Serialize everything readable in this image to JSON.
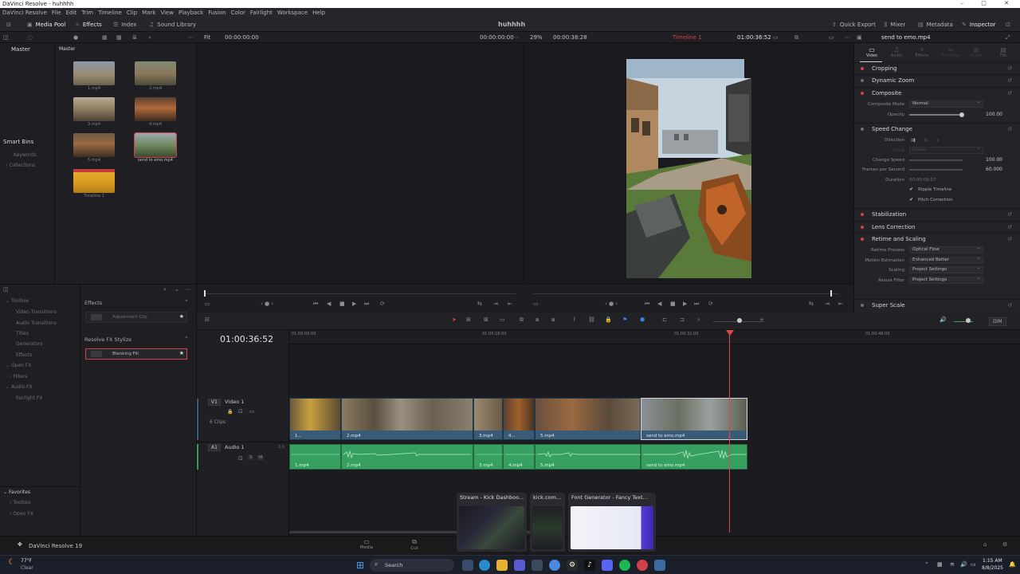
{
  "window": {
    "title": "DaVinci Resolve - huhhhh",
    "controls": [
      "–",
      "□",
      "✕"
    ]
  },
  "menu": [
    "DaVinci Resolve",
    "File",
    "Edit",
    "Trim",
    "Timeline",
    "Clip",
    "Mark",
    "View",
    "Playback",
    "Fusion",
    "Color",
    "Fairlight",
    "Workspace",
    "Help"
  ],
  "toolbar": {
    "media_pool": "Media Pool",
    "effects": "Effects",
    "index": "Index",
    "sound_library": "Sound Library",
    "project_title": "huhhhh",
    "quick_export": "Quick Export",
    "mixer": "Mixer",
    "metadata": "Metadata",
    "inspector": "Inspector"
  },
  "subbar": {
    "fit": "Fit",
    "source_tc": "00:00:00:00",
    "source_tc2": "00:00:00:00",
    "zoom": "29%",
    "program_dur": "00:00:38:28",
    "timeline_name": "Timeline 1",
    "program_tc": "01:00:36:52",
    "inspector_clip": "send to emo.mp4"
  },
  "bins": {
    "master_label": "Master",
    "pool_master": "Master",
    "smart_bins": "Smart Bins",
    "keywords": "Keywords",
    "collections": "Collections"
  },
  "media": [
    {
      "label": "1.mp4"
    },
    {
      "label": "2.mp4"
    },
    {
      "label": "3.mp4"
    },
    {
      "label": "4.mp4"
    },
    {
      "label": "5.mp4"
    },
    {
      "label": "send to emo.mp4"
    },
    {
      "label": "Timeline 1"
    }
  ],
  "inspector": {
    "tabs": [
      "Video",
      "Audio",
      "Effects",
      "Transition",
      "Image",
      "File"
    ],
    "sections": {
      "cropping": "Cropping",
      "dynamic_zoom": "Dynamic Zoom",
      "composite": "Composite",
      "speed_change": "Speed Change",
      "stabilization": "Stabilization",
      "lens_correction": "Lens Correction",
      "retime_scaling": "Retime and Scaling",
      "super_scale": "Super Scale"
    },
    "composite_mode_label": "Composite Mode",
    "composite_mode_value": "Normal",
    "opacity_label": "Opacity",
    "opacity_value": "100.00",
    "direction_label": "Direction",
    "clock_label": "Clock",
    "clock_value": "Linear",
    "change_speed_label": "Change Speed",
    "change_speed_value": "100.00",
    "fps_label": "Frames per Second",
    "fps_value": "60.000",
    "duration_label": "Duration",
    "duration_value": "00:00:09:07",
    "ripple_timeline": "Ripple Timeline",
    "pitch_correction": "Pitch Correction",
    "retime_process_label": "Retime Process",
    "retime_process_value": "Optical Flow",
    "motion_est_label": "Motion Estimation",
    "motion_est_value": "Enhanced Better",
    "scaling_label": "Scaling",
    "scaling_value": "Project Settings",
    "resize_filter_label": "Resize Filter",
    "resize_filter_value": "Project Settings"
  },
  "fx_tree": {
    "toolbox": "Toolbox",
    "video_transitions": "Video Transitions",
    "audio_transitions": "Audio Transitions",
    "titles": "Titles",
    "generators": "Generators",
    "effects": "Effects",
    "open_fx": "Open FX",
    "filters": "Filters",
    "audio_fx": "Audio FX",
    "fairlight_fx": "Fairlight FX",
    "favorites": "Favorites",
    "fav_toolbox": "Toolbox",
    "fav_openfx": "Open FX"
  },
  "fx_list": {
    "effects_header": "Effects",
    "adjustment_clip": "Adjustment Clip",
    "stylize_header": "Resolve FX Stylize",
    "blanking_fill": "Blanking Fill"
  },
  "timeline": {
    "timecode": "01:00:36:52",
    "ruler": [
      "01:00:00:00",
      "01:00:16:00",
      "01:00:32:00",
      "01:00:48:00"
    ],
    "v1_tag": "V1",
    "v1_name": "Video 1",
    "v1_count": "6 Clips",
    "a1_tag": "A1",
    "a1_name": "Audio 1",
    "a1_ch": "2.0",
    "dim": "DIM",
    "video_clips": [
      "1...",
      "2.mp4",
      "3.mp4",
      "4...",
      "5.mp4",
      "send to emo.mp4"
    ],
    "audio_clips": [
      "1.mp4",
      "2.mp4",
      "3.mp4",
      "4.mp4",
      "5.mp4",
      "send to emo.mp4"
    ]
  },
  "pagebar": {
    "app": "DaVinci Resolve 19",
    "media": "Media",
    "cut": "Cut"
  },
  "alttab": [
    {
      "title": "Stream - Kick Dashboo..."
    },
    {
      "title": "kick.com..."
    },
    {
      "title": "Font Generator - Fancy Text..."
    }
  ],
  "taskbar": {
    "weather_temp": "77°F",
    "weather_desc": "Clear",
    "search": "Search",
    "time": "1:15 AM",
    "date": "8/8/2025"
  }
}
